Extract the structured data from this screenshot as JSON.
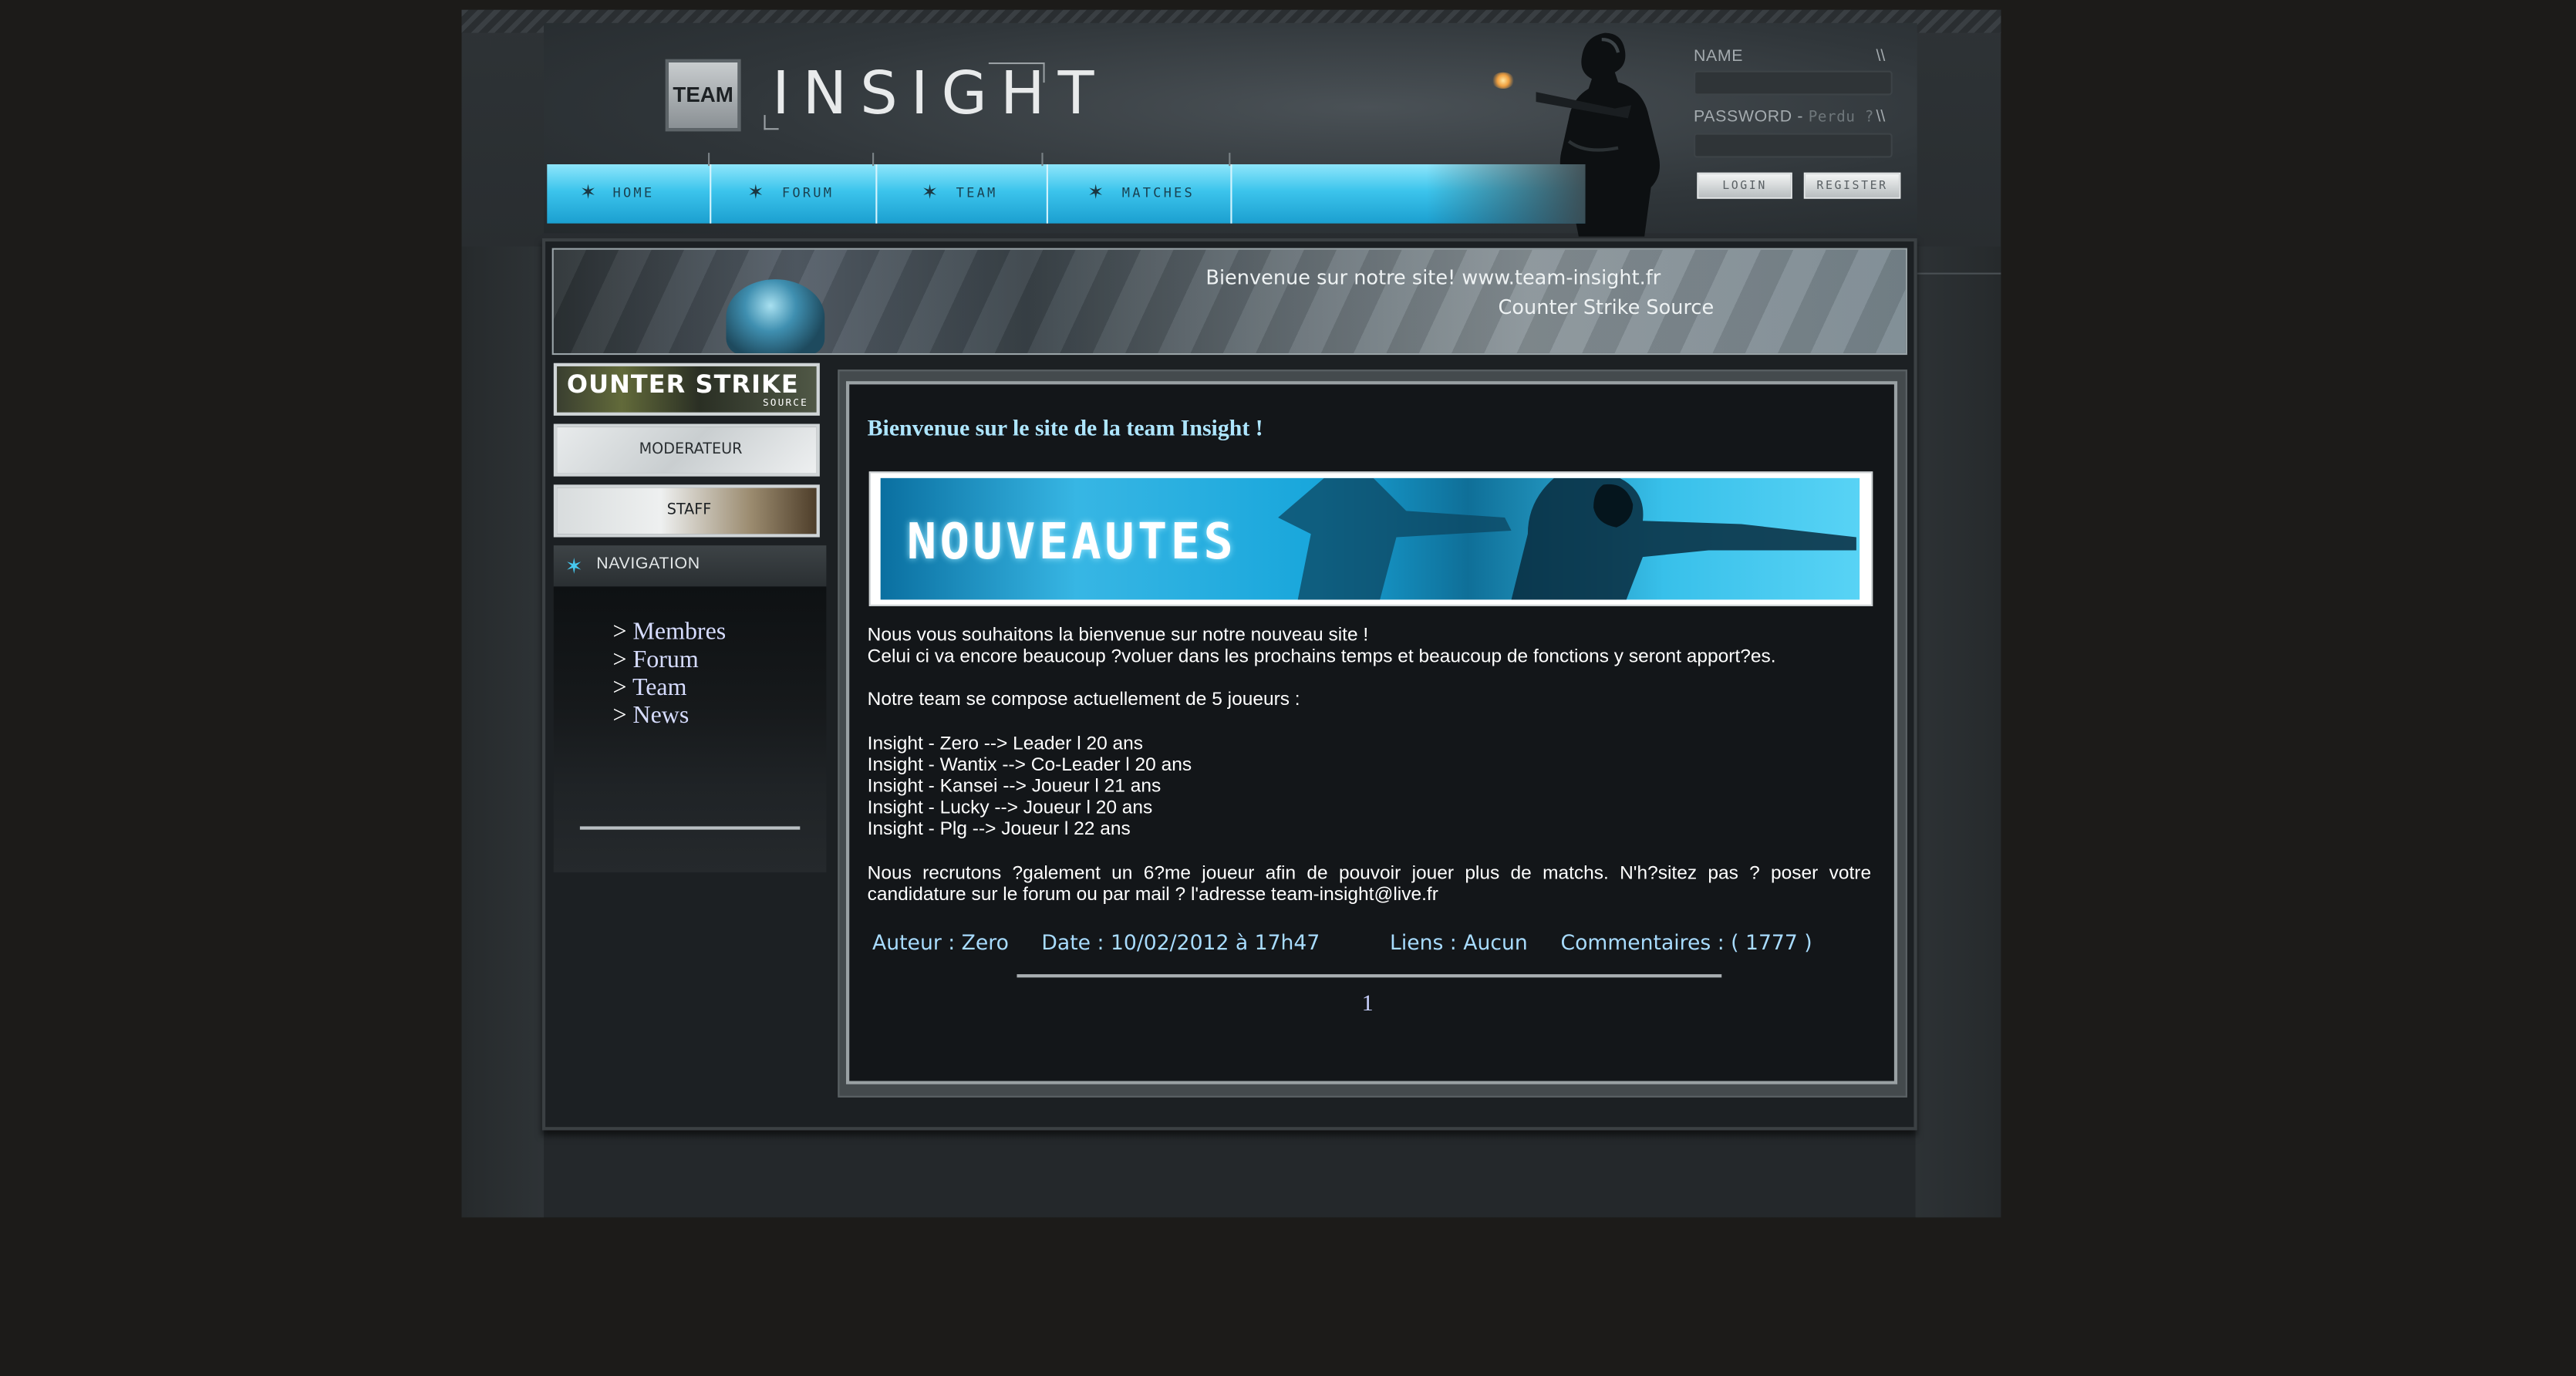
{
  "header": {
    "logo_team": "TEAM",
    "logo_insight": "INSIGHT"
  },
  "nav": {
    "items": [
      {
        "label": "HOME",
        "icon": "star-icon"
      },
      {
        "label": "FORUM",
        "icon": "star-icon"
      },
      {
        "label": "TEAM",
        "icon": "star-icon"
      },
      {
        "label": "MATCHES",
        "icon": "star-icon"
      }
    ]
  },
  "login": {
    "name_label": "NAME",
    "password_label": "PASSWORD - ",
    "forgot_label": "Perdu ?",
    "slashes": "\\\\",
    "login_button": "LOGIN",
    "register_button": "REGISTER"
  },
  "banner": {
    "line1": "Bienvenue sur notre site! www.team-insight.fr",
    "line2": "Counter Strike Source"
  },
  "sidebar": {
    "cs_title": "OUNTER STRIKE",
    "cs_sub": "SOURCE",
    "moderateur": "MODERATEUR",
    "staff": "STAFF",
    "navigation_title": "NAVIGATION",
    "links": [
      {
        "arrow": "> ",
        "label": "Membres"
      },
      {
        "arrow": "> ",
        "label": "Forum"
      },
      {
        "arrow": "> ",
        "label": "Team"
      },
      {
        "arrow": "> ",
        "label": "News"
      }
    ]
  },
  "content": {
    "title": "Bienvenue sur le site de la team Insight !",
    "news_banner": "NOUVEAUTES",
    "intro1": "Nous vous souhaitons la bienvenue sur notre nouveau site !",
    "intro2": "Celui ci va encore beaucoup ?voluer dans les prochains temps et beaucoup de fonctions y seront apport?es.",
    "team_intro": "Notre team se compose actuellement de 5 joueurs :",
    "players": [
      "Insight - Zero --> Leader l 20 ans",
      "Insight - Wantix --> Co-Leader l 20 ans",
      "Insight - Kansei --> Joueur l 21 ans",
      "Insight - Lucky --> Joueur l 20 ans",
      "Insight - Plg --> Joueur l 22 ans"
    ],
    "recruit": "Nous recrutons ?galement un 6?me joueur afin de pouvoir jouer plus de matchs. N'h?sitez pas ? poser votre candidature sur le forum ou par mail ? l'adresse team-insight@live.fr",
    "meta": {
      "author": "Auteur : Zero",
      "date": "Date : 10/02/2012 à 17h47",
      "links": "Liens : Aucun",
      "comments": "Commentaires : ( 1777 )"
    },
    "page": "1"
  },
  "colors": {
    "accent": "#3cc4ec",
    "title": "#aee6ff",
    "meta": "#a8dcff",
    "link": "#d6dcff"
  }
}
